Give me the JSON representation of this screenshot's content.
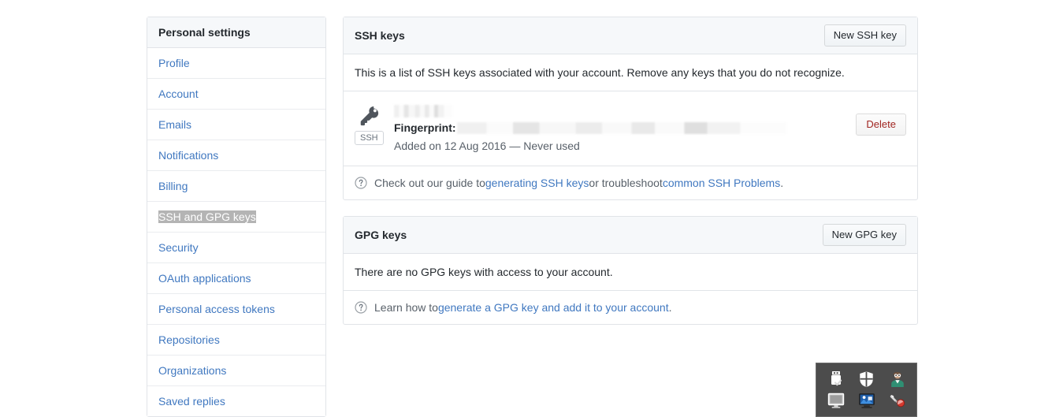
{
  "sidebar": {
    "header": "Personal settings",
    "items": [
      {
        "label": "Profile",
        "selected": false
      },
      {
        "label": "Account",
        "selected": false
      },
      {
        "label": "Emails",
        "selected": false
      },
      {
        "label": "Notifications",
        "selected": false
      },
      {
        "label": "Billing",
        "selected": false
      },
      {
        "label": "SSH and GPG keys",
        "selected": true
      },
      {
        "label": "Security",
        "selected": false
      },
      {
        "label": "OAuth applications",
        "selected": false
      },
      {
        "label": "Personal access tokens",
        "selected": false
      },
      {
        "label": "Repositories",
        "selected": false
      },
      {
        "label": "Organizations",
        "selected": false
      },
      {
        "label": "Saved replies",
        "selected": false
      }
    ]
  },
  "ssh_panel": {
    "title": "SSH keys",
    "new_button": "New SSH key",
    "description": "This is a list of SSH keys associated with your account. Remove any keys that you do not recognize.",
    "key": {
      "badge": "SSH",
      "title_redacted": true,
      "fingerprint_label": "Fingerprint:",
      "fingerprint_redacted": true,
      "meta": "Added on 12 Aug 2016 — Never used",
      "delete_button": "Delete"
    },
    "help": {
      "text_before": "Check out our guide to ",
      "link1": "generating SSH keys",
      "text_middle": " or troubleshoot ",
      "link2": "common SSH Problems",
      "text_after": "."
    }
  },
  "gpg_panel": {
    "title": "GPG keys",
    "new_button": "New GPG key",
    "empty_text": "There are no GPG keys with access to your account.",
    "help": {
      "text_before": "Learn how to ",
      "link1": "generate a GPG key and add it to your account",
      "text_after": "."
    }
  },
  "tray": {
    "icons": [
      {
        "name": "usb-safely-remove-icon"
      },
      {
        "name": "windows-defender-shield-icon"
      },
      {
        "name": "user-account-icon"
      },
      {
        "name": "display-monitor-icon"
      },
      {
        "name": "remote-desktop-icon"
      },
      {
        "name": "network-tools-icon"
      }
    ]
  },
  "colors": {
    "link": "#4078c0",
    "danger": "#a12621",
    "panel_header_bg": "#f6f8fa",
    "border": "#e1e4e8",
    "selection_highlight": "#b4b4b4",
    "tray_bg": "#4c4c4c"
  }
}
